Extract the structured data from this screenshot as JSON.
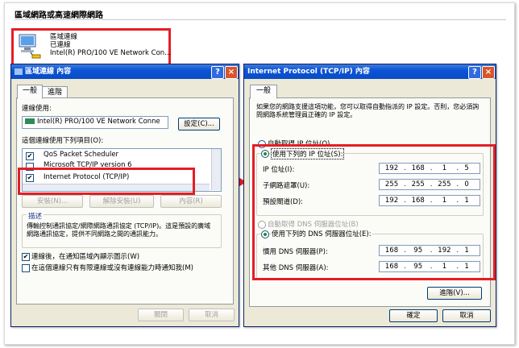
{
  "heading": "區域網路或高速網際網路",
  "connection": {
    "name": "區域連線",
    "status": "已連線",
    "adapter": "Intel(R) PRO/100 VE Network Con..."
  },
  "left_dialog": {
    "title": "區域連線 內容",
    "tabs": [
      "一般",
      "進階"
    ],
    "connect_using_label": "連線使用:",
    "adapter_field": "Intel(R) PRO/100 VE Network Conne",
    "configure_btn": "設定(C)...",
    "items_label": "這個連線使用下列項目(O):",
    "items": [
      "QoS Packet Scheduler",
      "Microsoft TCP/IP version 6",
      "Internet Protocol (TCP/IP)"
    ],
    "install_btn": "安裝(N)...",
    "uninstall_btn": "解除安裝(U)",
    "properties_btn": "內容(R)",
    "desc_label": "描述",
    "desc_text": "傳輸控制通訊協定/網際網路通訊協定 (TCP/IP)。這是預設的廣域網路通訊協定，提供不同網路之間的通訊能力。",
    "show_icon_cb": "連線後，在通知區域內顯示圖示(W)",
    "notify_cb": "在這個連線只有有限連線或沒有連線能力時通知我(M)",
    "close_btn": "關閉",
    "cancel_btn": "取消",
    "help_glyph": "?",
    "close_glyph": "×"
  },
  "right_dialog": {
    "title": "Internet Protocol (TCP/IP) 內容",
    "tab": "一般",
    "intro": "如果您的網路支援這項功能，您可以取得自動指派的 IP 設定。否則，您必須詢問網路系統管理員正確的 IP 設定。",
    "auto_ip": "自動取得 IP 位址(O)",
    "manual_ip": "使用下列的 IP 位址(S):",
    "ip_label": "IP 位址(I):",
    "ip_value": [
      "192",
      "168",
      "1",
      "5"
    ],
    "mask_label": "子網路遮罩(U):",
    "mask_value": [
      "255",
      "255",
      "255",
      "0"
    ],
    "gateway_label": "預設閘道(D):",
    "gateway_value": [
      "192",
      "168",
      "1",
      "1"
    ],
    "auto_dns": "自動取得 DNS 伺服器位址(B)",
    "manual_dns": "使用下列的 DNS 伺服器位址(E):",
    "pref_dns_label": "慣用 DNS 伺服器(P):",
    "pref_dns_value": [
      "168",
      "95",
      "192",
      "1"
    ],
    "alt_dns_label": "其他 DNS 伺服器(A):",
    "alt_dns_value": [
      "168",
      "95",
      "1",
      "1"
    ],
    "advanced_btn": "進階(V)...",
    "ok_btn": "確定",
    "cancel_btn": "取消",
    "help_glyph": "?",
    "close_glyph": "×"
  },
  "colors": {
    "annotation_red": "#e31e24",
    "titlebar_blue": "#0b54d8"
  }
}
